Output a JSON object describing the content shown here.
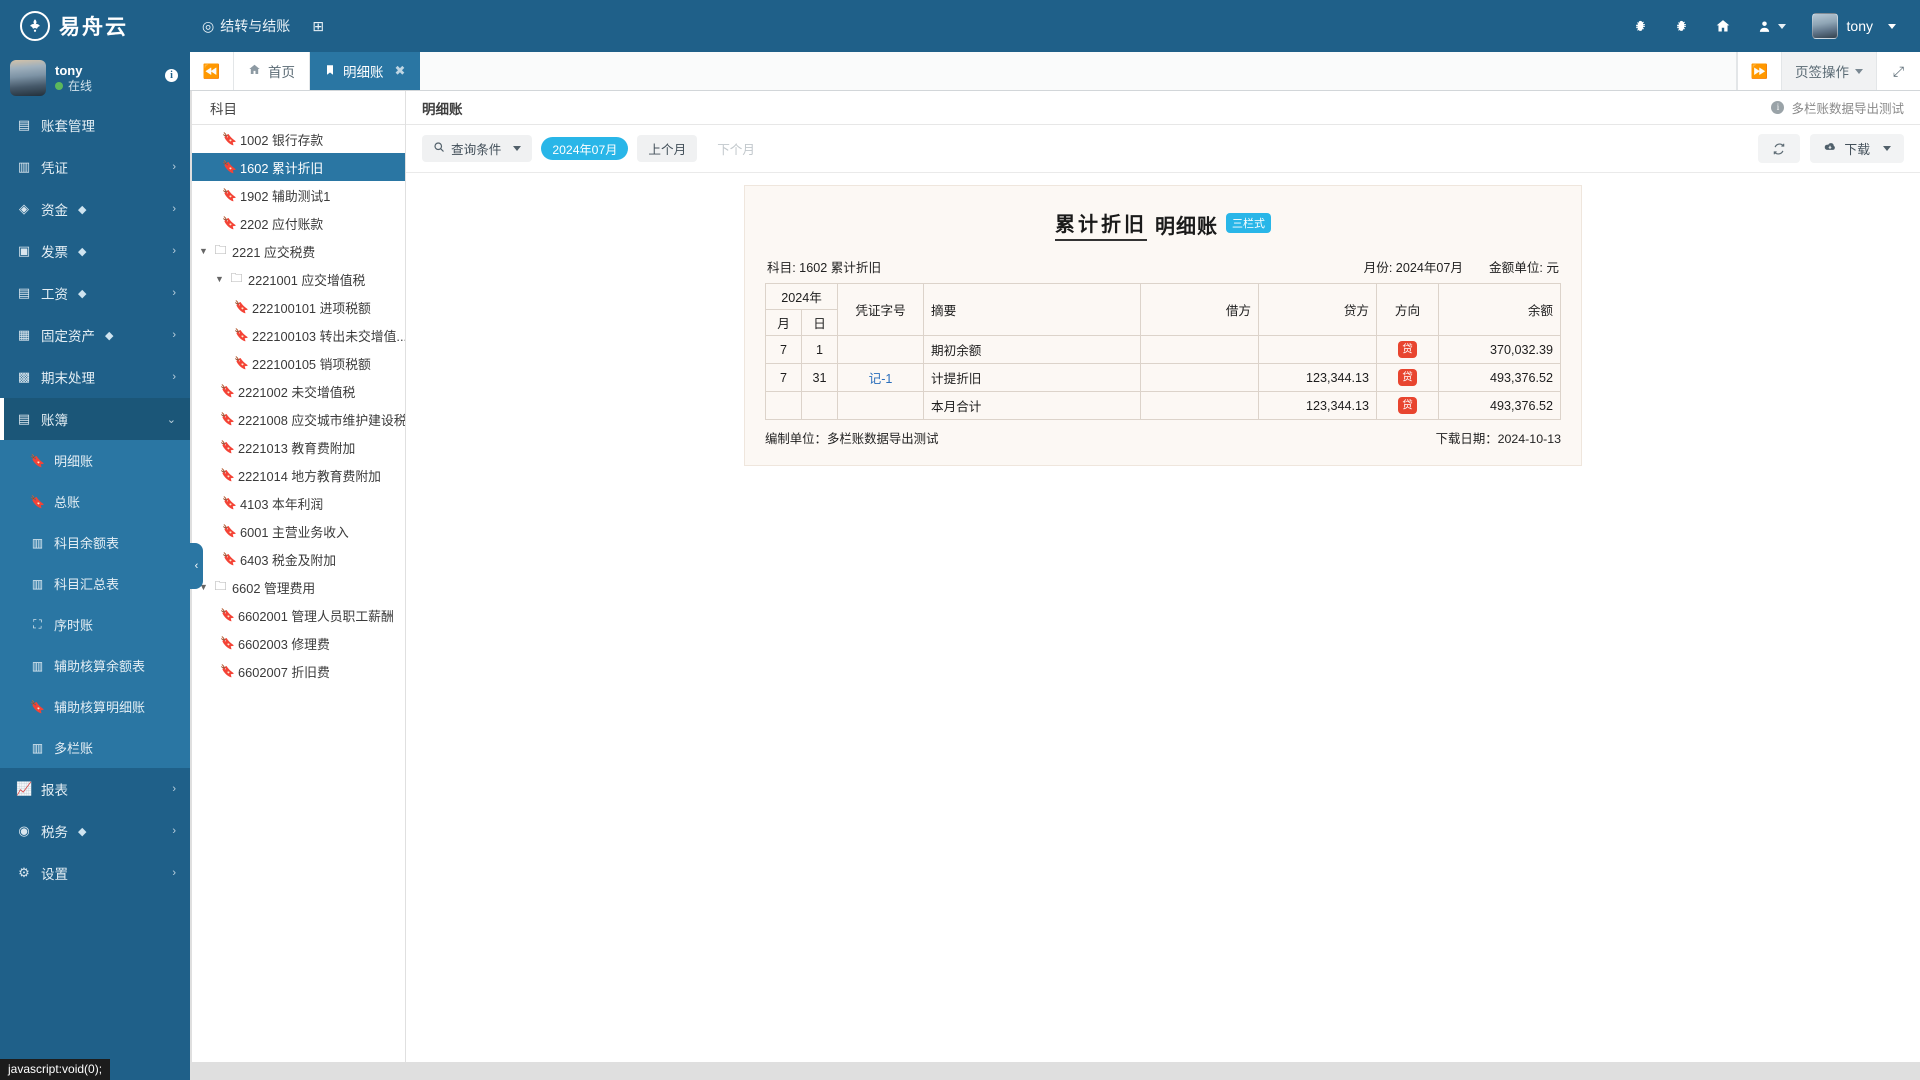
{
  "header": {
    "brand_name": "易舟云",
    "brand_logo_icon": "lotus-logo-icon",
    "menu": [
      {
        "label": "结转与结账",
        "icon": "target-icon"
      },
      {
        "label": "",
        "icon": "grid-add-icon"
      }
    ],
    "right_icons": [
      "bug-icon",
      "bug-alt-icon",
      "home-icon",
      "user-switch-icon"
    ],
    "user_name": "tony"
  },
  "sidebar": {
    "profile": {
      "name": "tony",
      "status": "在线",
      "info_icon": "info-icon",
      "avatar": "user-avatar"
    },
    "items": [
      {
        "label": "账套管理",
        "icon": "book-set-icon",
        "arrow": "",
        "gem": false
      },
      {
        "label": "凭证",
        "icon": "voucher-icon",
        "arrow": "›",
        "gem": false
      },
      {
        "label": "资金",
        "icon": "fund-icon",
        "arrow": "›",
        "gem": true
      },
      {
        "label": "发票",
        "icon": "invoice-icon",
        "arrow": "›",
        "gem": true
      },
      {
        "label": "工资",
        "icon": "salary-icon",
        "arrow": "›",
        "gem": true
      },
      {
        "label": "固定资产",
        "icon": "asset-icon",
        "arrow": "›",
        "gem": true
      },
      {
        "label": "期末处理",
        "icon": "calendar-icon",
        "arrow": "›",
        "gem": false
      },
      {
        "label": "账簿",
        "icon": "ledger-icon",
        "arrow": "⌄",
        "gem": false,
        "active": true
      }
    ],
    "subitems": [
      {
        "label": "明细账",
        "icon": "bookmark-icon"
      },
      {
        "label": "总账",
        "icon": "bookmark-icon"
      },
      {
        "label": "科目余额表",
        "icon": "columns-icon"
      },
      {
        "label": "科目汇总表",
        "icon": "columns-icon"
      },
      {
        "label": "序时账",
        "icon": "crop-icon"
      },
      {
        "label": "辅助核算余额表",
        "icon": "columns-icon"
      },
      {
        "label": "辅助核算明细账",
        "icon": "bookmark-icon"
      },
      {
        "label": "多栏账",
        "icon": "columns-icon"
      }
    ],
    "items_after": [
      {
        "label": "报表",
        "icon": "chart-icon",
        "arrow": "›",
        "gem": false
      },
      {
        "label": "税务",
        "icon": "tax-icon",
        "arrow": "›",
        "gem": true
      },
      {
        "label": "设置",
        "icon": "gear-icon",
        "arrow": "›",
        "gem": false
      }
    ]
  },
  "tabbar": {
    "prev_icon": "double-chevron-left-icon",
    "next_icon": "double-chevron-right-icon",
    "tabs": [
      {
        "label": "首页",
        "icon": "home-icon",
        "active": false,
        "closable": false
      },
      {
        "label": "明细账",
        "icon": "bookmark-icon",
        "active": true,
        "closable": true
      }
    ],
    "options_label": "页签操作",
    "expand_icon": "expand-icon"
  },
  "tree": {
    "header": "科目",
    "rows": [
      {
        "label": "1002 银行存款",
        "depth": 0,
        "icon": "bookmark-icon",
        "toggle": "",
        "selected": false
      },
      {
        "label": "1602 累计折旧",
        "depth": 0,
        "icon": "bookmark-icon",
        "toggle": "",
        "selected": true
      },
      {
        "label": "1902 辅助测试1",
        "depth": 0,
        "icon": "bookmark-icon",
        "toggle": "",
        "selected": false
      },
      {
        "label": "2202 应付账款",
        "depth": 0,
        "icon": "bookmark-icon",
        "toggle": "",
        "selected": false
      },
      {
        "label": "2221 应交税费",
        "depth": 0,
        "icon": "folder-icon",
        "toggle": "▼",
        "selected": false
      },
      {
        "label": "2221001 应交增值税",
        "depth": 1,
        "icon": "folder-icon",
        "toggle": "▼",
        "selected": false
      },
      {
        "label": "222100101 进项税额",
        "depth": 2,
        "icon": "bookmark-icon",
        "toggle": "",
        "selected": false
      },
      {
        "label": "222100103 转出未交增值...",
        "depth": 2,
        "icon": "bookmark-icon",
        "toggle": "",
        "selected": false
      },
      {
        "label": "222100105 销项税额",
        "depth": 2,
        "icon": "bookmark-icon",
        "toggle": "",
        "selected": false
      },
      {
        "label": "2221002 未交增值税",
        "depth": 1,
        "icon": "bookmark-icon",
        "toggle": "",
        "selected": false
      },
      {
        "label": "2221008 应交城市维护建设税",
        "depth": 1,
        "icon": "bookmark-icon",
        "toggle": "",
        "selected": false
      },
      {
        "label": "2221013 教育费附加",
        "depth": 1,
        "icon": "bookmark-icon",
        "toggle": "",
        "selected": false
      },
      {
        "label": "2221014 地方教育费附加",
        "depth": 1,
        "icon": "bookmark-icon",
        "toggle": "",
        "selected": false
      },
      {
        "label": "4103 本年利润",
        "depth": 0,
        "icon": "bookmark-icon",
        "toggle": "",
        "selected": false
      },
      {
        "label": "6001 主营业务收入",
        "depth": 0,
        "icon": "bookmark-icon",
        "toggle": "",
        "selected": false
      },
      {
        "label": "6403 税金及附加",
        "depth": 0,
        "icon": "bookmark-icon",
        "toggle": "",
        "selected": false
      },
      {
        "label": "6602 管理费用",
        "depth": 0,
        "icon": "folder-icon",
        "toggle": "▼",
        "selected": false
      },
      {
        "label": "6602001 管理人员职工薪酬",
        "depth": 1,
        "icon": "bookmark-icon",
        "toggle": "",
        "selected": false
      },
      {
        "label": "6602003 修理费",
        "depth": 1,
        "icon": "bookmark-icon",
        "toggle": "",
        "selected": false
      },
      {
        "label": "6602007 折旧费",
        "depth": 1,
        "icon": "bookmark-icon",
        "toggle": "",
        "selected": false
      }
    ]
  },
  "panel": {
    "title": "明细账",
    "corner_note": "多栏账数据导出测试",
    "corner_icon": "info-icon"
  },
  "toolbar": {
    "filter_label": "查询条件",
    "filter_icon": "search-icon",
    "period_label": "2024年07月",
    "prev_month_label": "上个月",
    "next_month_label": "下个月",
    "refresh_icon": "refresh-icon",
    "download_label": "下载",
    "download_icon": "cloud-download-icon"
  },
  "report": {
    "title_subject": "累计折旧",
    "title_kind": "明细账",
    "style_badge": "三栏式",
    "subject_label": "科目: 1602 累计折旧",
    "month_label": "月份: 2024年07月",
    "unit_label": "金额单位: 元",
    "year_header": "2024年",
    "columns": {
      "month": "月",
      "day": "日",
      "voucher": "凭证字号",
      "summary": "摘要",
      "debit": "借方",
      "credit": "贷方",
      "direction": "方向",
      "balance": "余额"
    },
    "rows": [
      {
        "month": "7",
        "day": "1",
        "voucher": "",
        "summary": "期初余额",
        "debit": "",
        "credit": "",
        "direction": "贷",
        "balance": "370,032.39"
      },
      {
        "month": "7",
        "day": "31",
        "voucher": "记-1",
        "summary": "计提折旧",
        "debit": "",
        "credit": "123,344.13",
        "direction": "贷",
        "balance": "493,376.52"
      },
      {
        "month": "",
        "day": "",
        "voucher": "",
        "summary": "本月合计",
        "debit": "",
        "credit": "123,344.13",
        "direction": "贷",
        "balance": "493,376.52"
      }
    ],
    "footer_left": "编制单位：多栏账数据导出测试",
    "footer_right": "下载日期：2024-10-13"
  },
  "statusbar": {
    "text": "javascript:void(0);"
  },
  "collapse_handle": {
    "icon": "chevron-left-icon"
  },
  "colors": {
    "brand_blue": "#1f6089",
    "accent_blue": "#2a76a3",
    "cyan": "#29b6e8",
    "red": "#e8452f",
    "report_bg": "#fcf8f4"
  }
}
